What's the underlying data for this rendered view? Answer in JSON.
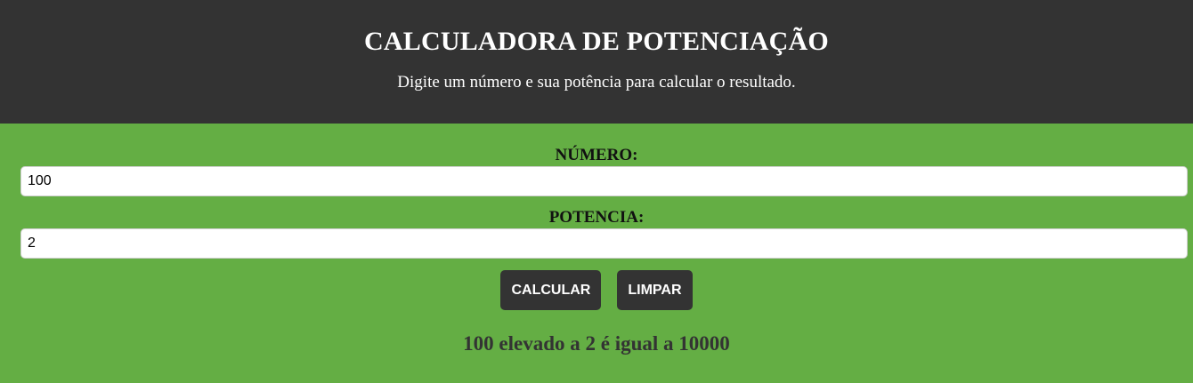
{
  "header": {
    "title": "CALCULADORA DE POTENCIAÇÃO",
    "subtitle": "Digite um número e sua potência para calcular o resultado."
  },
  "form": {
    "numero_label": "NÚMERO:",
    "numero_value": "100",
    "potencia_label": "POTENCIA:",
    "potencia_value": "2"
  },
  "buttons": {
    "calcular_label": "CALCULAR",
    "limpar_label": "LIMPAR"
  },
  "result": {
    "text": "100 elevado a 2 é igual a 10000"
  },
  "colors": {
    "header_bg": "#333333",
    "main_bg": "#64ae44",
    "button_bg": "#333333",
    "result_text": "#333333"
  }
}
